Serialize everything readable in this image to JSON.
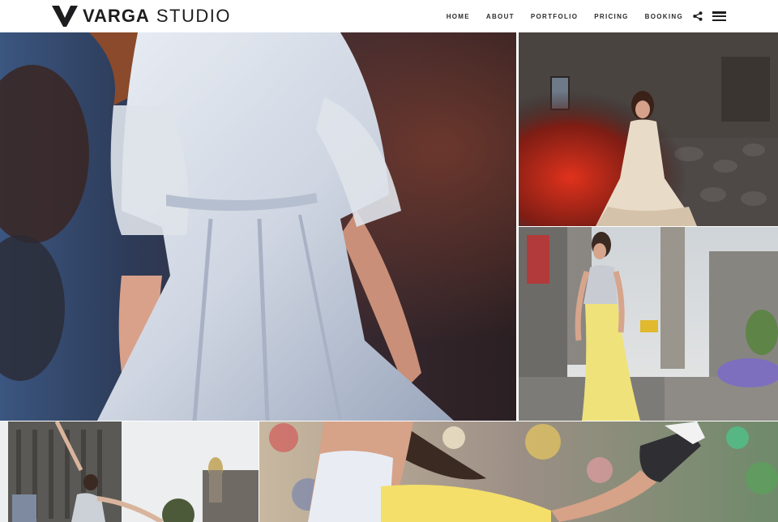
{
  "brand": {
    "name_bold": "VARGA",
    "name_light": "STUDIO"
  },
  "nav": {
    "items": [
      {
        "label": "HOME"
      },
      {
        "label": "ABOUT"
      },
      {
        "label": "PORTFOLIO"
      },
      {
        "label": "PRICING"
      },
      {
        "label": "BOOKING"
      }
    ],
    "share_icon": "share-icon",
    "menu_icon": "hamburger-menu-icon"
  },
  "gallery": {
    "photos": [
      {
        "subject": "woman in white lace dress at dusk"
      },
      {
        "subject": "woman in white dress by stone wall with red light"
      },
      {
        "subject": "woman in yellow skirt on city street"
      },
      {
        "subject": "dancer in front of buildings"
      },
      {
        "subject": "dancer with arm raised, blurred background"
      }
    ]
  },
  "colors": {
    "header_bg": "#ffffff",
    "text_dark": "#1d1d1f"
  }
}
